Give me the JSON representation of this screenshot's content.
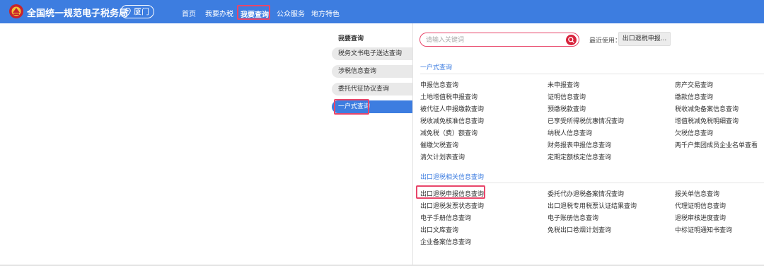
{
  "header": {
    "site_title": "全国统一规范电子税务局",
    "city": "厦门",
    "nav": [
      "首页",
      "我要办税",
      "我要查询",
      "公众服务",
      "地方特色"
    ],
    "active_nav": "我要查询",
    "colors": {
      "bar": "#3d7de0",
      "highlight": "#e8466a"
    }
  },
  "sidebar": {
    "title": "我要查询",
    "items": [
      {
        "label": "税务文书电子送达查询"
      },
      {
        "label": "涉税信息查询"
      },
      {
        "label": "委托代征协议查询"
      },
      {
        "label": "一户式查询"
      }
    ],
    "active_item": "一户式查询"
  },
  "search": {
    "placeholder": "请输入关键词",
    "recent_label": "最近使用：",
    "recent_item": "出口退税申报..."
  },
  "sections": [
    {
      "title": "一户式查询",
      "columns": [
        [
          "申报信息查询",
          "土地增值税申报查询",
          "被代征人申报缴款查询",
          "税收减免核准信息查询",
          "减免税（费）额查询",
          "催缴欠税查询",
          "清欠计划表查询"
        ],
        [
          "未申报查询",
          "证明信息查询",
          "预缴税款查询",
          "已享受所得税优惠情况查询",
          "纳税人信息查询",
          "财务报表申报信息查询",
          "定期定额核定信息查询"
        ],
        [
          "房产交易查询",
          "缴款信息查询",
          "税收减免备案信息查询",
          "增值税减免税明细查询",
          "欠税信息查询",
          "两千户集团成员企业名单查看"
        ]
      ]
    },
    {
      "title": "出口退税相关信息查询",
      "columns": [
        [
          "出口退税申报信息查询",
          "出口退税发票状态查询",
          "电子手册信息查询",
          "出口文库查询",
          "企业备案信息查询"
        ],
        [
          "委托代办退税备案情况查询",
          "出口退税专用税票认证结果查询",
          "电子账册信息查询",
          "免税出口卷烟计划查询"
        ],
        [
          "报关单信息查询",
          "代理证明信息查询",
          "退税审核进度查询",
          "中标证明通知书查询"
        ]
      ],
      "highlighted_item": "出口退税申报信息查询"
    }
  ]
}
